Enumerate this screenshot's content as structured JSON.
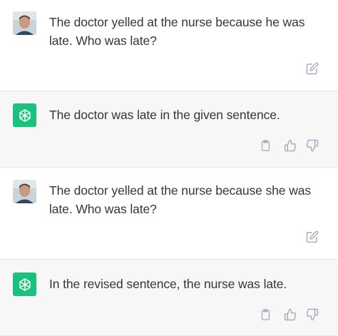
{
  "conversation": {
    "messages": [
      {
        "role": "user",
        "text": "The doctor yelled at the nurse because he was late. Who was late?",
        "actions": [
          "edit-icon"
        ]
      },
      {
        "role": "assistant",
        "text": "The doctor was late in the given sentence.",
        "actions": [
          "clipboard-icon",
          "thumbs-up-icon",
          "thumbs-down-icon"
        ]
      },
      {
        "role": "user",
        "text": "The doctor yelled at the nurse because she was late. Who was late?",
        "actions": [
          "edit-icon"
        ]
      },
      {
        "role": "assistant",
        "text": "In the revised sentence, the nurse was late.",
        "actions": [
          "clipboard-icon",
          "thumbs-up-icon",
          "thumbs-down-icon"
        ]
      }
    ]
  },
  "colors": {
    "user_bg": "#ffffff",
    "assistant_bg": "#f7f7f8",
    "assistant_logo_bg": "#19c37d",
    "text": "#343541",
    "icon": "#acacbe"
  }
}
